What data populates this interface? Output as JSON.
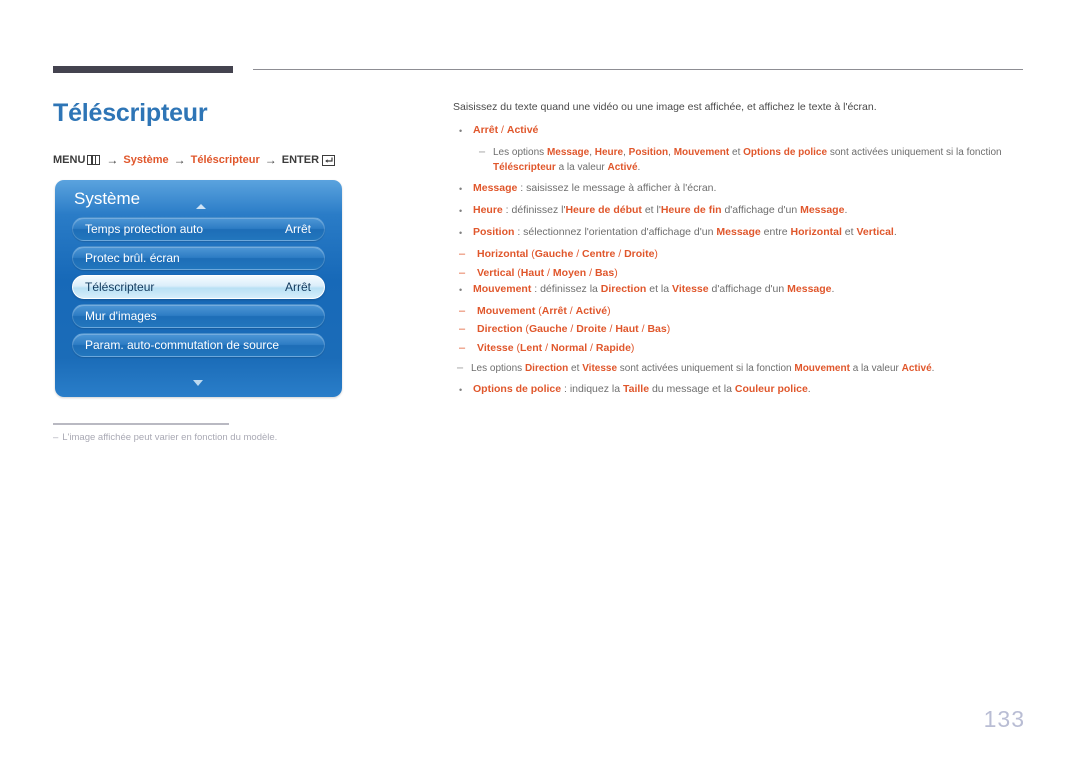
{
  "page": {
    "title": "Téléscripteur",
    "number": "133"
  },
  "menu_path": {
    "menu_label": "MENU",
    "menu_icon": "menu-bars-icon",
    "arrow": "→",
    "step1": "Système",
    "step2": "Téléscripteur",
    "enter_label": "ENTER",
    "enter_icon": "enter-key-icon"
  },
  "tv_menu": {
    "header": "Système",
    "scroll_up_icon": "triangle-up-icon",
    "scroll_down_icon": "triangle-down-icon",
    "rows": [
      {
        "label": "Temps protection auto",
        "value": "Arrêt",
        "selected": false
      },
      {
        "label": "Protec brûl. écran",
        "value": "",
        "selected": false
      },
      {
        "label": "Téléscripteur",
        "value": "Arrêt",
        "selected": true
      },
      {
        "label": "Mur d'images",
        "value": "",
        "selected": false
      },
      {
        "label": "Param. auto-commutation de source",
        "value": "",
        "selected": false
      }
    ]
  },
  "image_note": {
    "dash": "‒",
    "text": "L'image affichée peut varier en fonction du modèle."
  },
  "content": {
    "intro": "Saisissez du texte quand une vidéo ou une image est affichée, et affichez le texte à l'écran.",
    "bullet": "•",
    "dash": "‒",
    "items": [
      {
        "id": "arret-active",
        "kind": "bullet",
        "parts": [
          {
            "t": "Arrêt",
            "s": "o"
          },
          {
            "t": " / ",
            "s": "on"
          },
          {
            "t": "Activé",
            "s": "o"
          }
        ]
      },
      {
        "id": "note-telescripteur",
        "kind": "note",
        "parts": [
          {
            "t": "Les options ",
            "s": "g"
          },
          {
            "t": "Message",
            "s": "o"
          },
          {
            "t": ", ",
            "s": "g"
          },
          {
            "t": "Heure",
            "s": "o"
          },
          {
            "t": ", ",
            "s": "g"
          },
          {
            "t": "Position",
            "s": "o"
          },
          {
            "t": ", ",
            "s": "g"
          },
          {
            "t": "Mouvement",
            "s": "o"
          },
          {
            "t": " et ",
            "s": "g"
          },
          {
            "t": "Options de police",
            "s": "o"
          },
          {
            "t": " sont activées uniquement si la fonction ",
            "s": "g"
          },
          {
            "t": "Téléscripteur",
            "s": "o"
          },
          {
            "t": " a la valeur ",
            "s": "g"
          },
          {
            "t": "Activé",
            "s": "o"
          },
          {
            "t": ".",
            "s": "g"
          }
        ]
      },
      {
        "id": "message",
        "kind": "bullet",
        "parts": [
          {
            "t": "Message",
            "s": "o"
          },
          {
            "t": " : saisissez le message à afficher à l'écran.",
            "s": "g"
          }
        ]
      },
      {
        "id": "heure",
        "kind": "bullet",
        "parts": [
          {
            "t": "Heure",
            "s": "o"
          },
          {
            "t": " : définissez l'",
            "s": "g"
          },
          {
            "t": "Heure de début",
            "s": "o"
          },
          {
            "t": " et l'",
            "s": "g"
          },
          {
            "t": "Heure de fin",
            "s": "o"
          },
          {
            "t": " d'affichage d'un ",
            "s": "g"
          },
          {
            "t": "Message",
            "s": "o"
          },
          {
            "t": ".",
            "s": "g"
          }
        ]
      },
      {
        "id": "position",
        "kind": "bullet",
        "parts": [
          {
            "t": "Position",
            "s": "o"
          },
          {
            "t": " : sélectionnez l'orientation d'affichage d'un ",
            "s": "g"
          },
          {
            "t": "Message",
            "s": "o"
          },
          {
            "t": " entre ",
            "s": "g"
          },
          {
            "t": "Horizontal",
            "s": "o"
          },
          {
            "t": " et ",
            "s": "g"
          },
          {
            "t": "Vertical",
            "s": "o"
          },
          {
            "t": ".",
            "s": "g"
          }
        ]
      },
      {
        "id": "position-horizontal",
        "kind": "sub",
        "parts": [
          {
            "t": "Horizontal",
            "s": "o"
          },
          {
            "t": " (",
            "s": "on"
          },
          {
            "t": "Gauche",
            "s": "o"
          },
          {
            "t": " / ",
            "s": "on"
          },
          {
            "t": "Centre",
            "s": "o"
          },
          {
            "t": " / ",
            "s": "on"
          },
          {
            "t": "Droite",
            "s": "o"
          },
          {
            "t": ")",
            "s": "on"
          }
        ]
      },
      {
        "id": "position-vertical",
        "kind": "sub",
        "parts": [
          {
            "t": "Vertical",
            "s": "o"
          },
          {
            "t": " (",
            "s": "on"
          },
          {
            "t": "Haut",
            "s": "o"
          },
          {
            "t": " / ",
            "s": "on"
          },
          {
            "t": "Moyen",
            "s": "o"
          },
          {
            "t": " / ",
            "s": "on"
          },
          {
            "t": "Bas",
            "s": "o"
          },
          {
            "t": ")",
            "s": "on"
          }
        ]
      },
      {
        "id": "mouvement",
        "kind": "bullet",
        "parts": [
          {
            "t": "Mouvement",
            "s": "o"
          },
          {
            "t": " : définissez la ",
            "s": "g"
          },
          {
            "t": "Direction",
            "s": "o"
          },
          {
            "t": " et la ",
            "s": "g"
          },
          {
            "t": "Vitesse",
            "s": "o"
          },
          {
            "t": " d'affichage d'un ",
            "s": "g"
          },
          {
            "t": "Message",
            "s": "o"
          },
          {
            "t": ".",
            "s": "g"
          }
        ]
      },
      {
        "id": "mouvement-sub",
        "kind": "sub",
        "parts": [
          {
            "t": "Mouvement",
            "s": "o"
          },
          {
            "t": " (",
            "s": "on"
          },
          {
            "t": "Arrêt",
            "s": "o"
          },
          {
            "t": " / ",
            "s": "on"
          },
          {
            "t": "Activé",
            "s": "o"
          },
          {
            "t": ")",
            "s": "on"
          }
        ]
      },
      {
        "id": "direction-sub",
        "kind": "sub",
        "parts": [
          {
            "t": "Direction",
            "s": "o"
          },
          {
            "t": " (",
            "s": "on"
          },
          {
            "t": "Gauche",
            "s": "o"
          },
          {
            "t": " / ",
            "s": "on"
          },
          {
            "t": "Droite",
            "s": "o"
          },
          {
            "t": " / ",
            "s": "on"
          },
          {
            "t": "Haut",
            "s": "o"
          },
          {
            "t": " / ",
            "s": "on"
          },
          {
            "t": "Bas",
            "s": "o"
          },
          {
            "t": ")",
            "s": "on"
          }
        ]
      },
      {
        "id": "vitesse-sub",
        "kind": "sub",
        "parts": [
          {
            "t": "Vitesse",
            "s": "o"
          },
          {
            "t": " (",
            "s": "on"
          },
          {
            "t": "Lent",
            "s": "o"
          },
          {
            "t": " / ",
            "s": "on"
          },
          {
            "t": "Normal",
            "s": "o"
          },
          {
            "t": " / ",
            "s": "on"
          },
          {
            "t": "Rapide",
            "s": "o"
          },
          {
            "t": ")",
            "s": "on"
          }
        ]
      },
      {
        "id": "note-mouvement",
        "kind": "note-indent",
        "parts": [
          {
            "t": "Les options ",
            "s": "g"
          },
          {
            "t": "Direction",
            "s": "o"
          },
          {
            "t": " et ",
            "s": "g"
          },
          {
            "t": "Vitesse",
            "s": "o"
          },
          {
            "t": " sont activées uniquement si la fonction ",
            "s": "g"
          },
          {
            "t": "Mouvement",
            "s": "o"
          },
          {
            "t": " a la valeur ",
            "s": "g"
          },
          {
            "t": "Activé",
            "s": "o"
          },
          {
            "t": ".",
            "s": "g"
          }
        ]
      },
      {
        "id": "options-police",
        "kind": "bullet",
        "parts": [
          {
            "t": "Options de police",
            "s": "o"
          },
          {
            "t": " : indiquez la ",
            "s": "g"
          },
          {
            "t": "Taille",
            "s": "o"
          },
          {
            "t": " du message et la ",
            "s": "g"
          },
          {
            "t": "Couleur police",
            "s": "o"
          },
          {
            "t": ".",
            "s": "g"
          }
        ]
      }
    ]
  },
  "colors": {
    "accent_orange": "#e0572c",
    "title_blue": "#2e75b6",
    "panel_blue": "#1d6db7",
    "note_gray": "#9a9a9a",
    "page_number": "#b9bdd4"
  }
}
